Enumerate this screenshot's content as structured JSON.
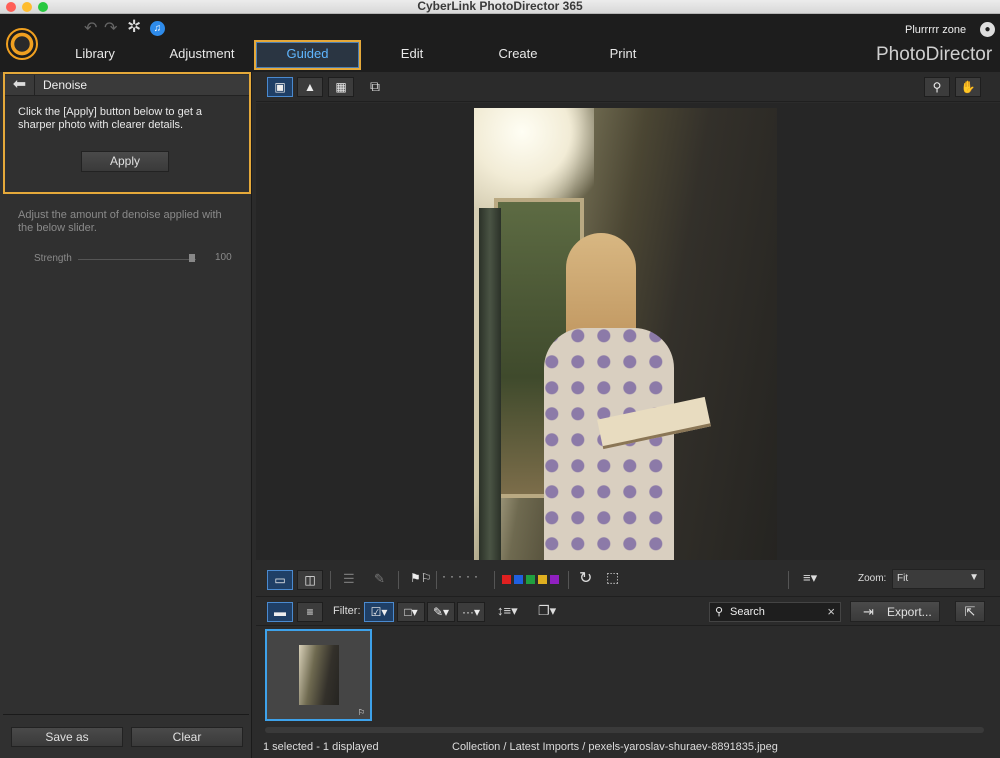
{
  "window": {
    "title": "CyberLink PhotoDirector 365"
  },
  "header": {
    "user": "Plurrrrr zone",
    "brand": "PhotoDirector",
    "tabs": [
      "Library",
      "Adjustment",
      "Guided",
      "Edit",
      "Create",
      "Print"
    ],
    "active_tab": "Guided"
  },
  "panel": {
    "title": "Denoise",
    "instructions": "Click the [Apply] button below to get a sharper photo with clearer details.",
    "apply_label": "Apply",
    "description": "Adjust the amount of denoise applied with the below slider.",
    "slider": {
      "label": "Strength",
      "value": "100"
    },
    "save_label": "Save as",
    "clear_label": "Clear"
  },
  "filmstrip_bar": {
    "filter_label": "Filter:",
    "zoom_label": "Zoom:",
    "zoom_value": "Fit",
    "search_placeholder": "Search",
    "export_label": "Export...",
    "color_labels": [
      "#e02020",
      "#2060e0",
      "#20a040",
      "#e0b020",
      "#9020c0"
    ]
  },
  "status": {
    "selection": "1 selected - 1 displayed",
    "path": "Collection / Latest Imports / pexels-yaroslav-shuraev-8891835.jpeg"
  }
}
